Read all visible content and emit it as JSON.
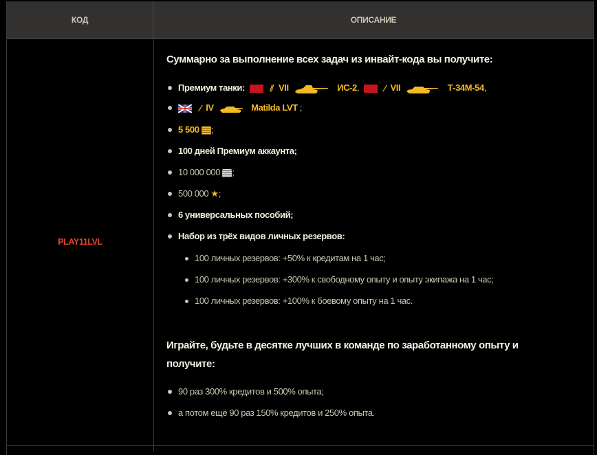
{
  "table": {
    "headers": {
      "code": "КОД",
      "description": "ОПИСАНИЕ"
    }
  },
  "row": {
    "code": "PLAY11LVL",
    "heading1": "Суммарно за выполнение всех задач из инвайт-кода вы получите:",
    "tanks": {
      "label": "Премиум танки:",
      "list": [
        {
          "nation": "ussr",
          "tier": "VII",
          "name": "ИС-2",
          "sep": ","
        },
        {
          "nation": "ussr",
          "tier": "VII",
          "name": "Т-34М-54",
          "sep": ","
        },
        {
          "nation": "uk",
          "tier": "IV",
          "name": "Matilda LVT",
          "sep": ";"
        }
      ]
    },
    "gold": {
      "value": "5 500",
      "suffix": ";"
    },
    "premium": "100 дней Премиум аккаунта;",
    "credits": {
      "value": "10 000 000",
      "suffix": ";"
    },
    "freexp": {
      "value": "500 000",
      "suffix": ";"
    },
    "manuals": "6 универсальных пособий;",
    "reserves_label": "Набор из трёх видов личных резервов:",
    "reserves": [
      "100 личных резервов: +50% к кредитам на 1 час;",
      "100 личных резервов: +300% к свободному опыту и опыту экипажа на 1 час;",
      "100 личных резервов: +100% к боевому опыту на 1 час."
    ],
    "heading2_line1": "Играйте, будьте в десятке лучших в команде по заработанному опыту и",
    "heading2_line2": "получите:",
    "bonuses": [
      "90 раз 300% кредитов и 500% опыта;",
      "а потом ещё 90 раз 150% кредитов и 250% опыта."
    ]
  },
  "colors": {
    "accent_gold": "#f5b921",
    "code_red": "#e0462a",
    "header_bg": "#323130"
  }
}
